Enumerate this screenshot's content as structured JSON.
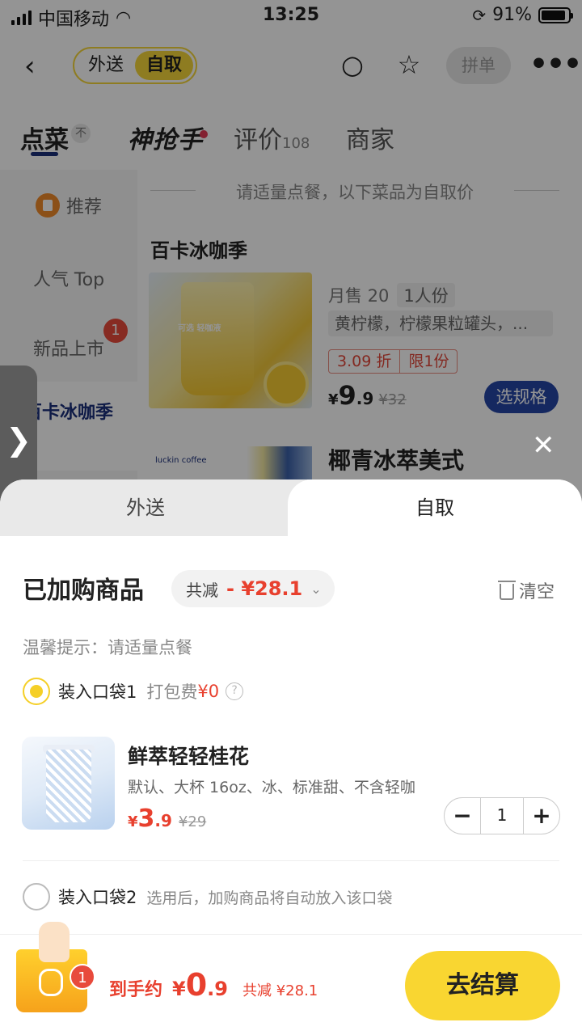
{
  "status_bar": {
    "carrier": "中国移动",
    "time": "13:25",
    "battery": "91%"
  },
  "nav": {
    "mode_delivery": "外送",
    "mode_pickup": "自取",
    "group_order": "拼单"
  },
  "tabs": {
    "order": "点菜",
    "order_badge": "不",
    "brand": "神抢手",
    "review": "评价",
    "review_count": "108",
    "merchant": "商家"
  },
  "sidebar": {
    "items": [
      {
        "label": "推荐"
      },
      {
        "label": "人气 Top"
      },
      {
        "label": "新品上市",
        "badge": "1"
      },
      {
        "label": "百卡冰咖季"
      }
    ]
  },
  "menu": {
    "notice": "请适量点餐，以下菜品为自取价",
    "section_title": "百卡冰咖季",
    "product1": {
      "image_text": "可选 轻咖液",
      "monthly_sales": "月售 20",
      "serving": "1人份",
      "desc": "黄柠檬，柠檬果粒罐头，...",
      "discount": "3.09 折",
      "limit": "限1份",
      "price_currency": "¥",
      "price_int": "9",
      "price_dec": ".9",
      "orig_price": "¥32",
      "spec_button": "选规格"
    },
    "product2": {
      "logo": "luckin coffee",
      "title": "椰青冰萃美式"
    }
  },
  "sheet": {
    "tab_delivery": "外送",
    "tab_pickup": "自取",
    "title": "已加购商品",
    "reduce_label": "共减",
    "reduce_amount": "- ¥28.1",
    "clear": "清空",
    "tip": "温馨提示：请适量点餐",
    "bag1": {
      "label": "装入口袋1",
      "fee_label": "打包费",
      "fee": "¥0"
    },
    "item": {
      "title": "鲜萃轻轻桂花",
      "spec": "默认、大杯 16oz、冰、标准甜、不含轻咖",
      "price_currency": "¥",
      "price_int": "3",
      "price_dec": ".9",
      "orig_price": "¥29",
      "quantity": "1"
    },
    "bag2": {
      "label": "装入口袋2",
      "hint": "选用后，加购商品将自动放入该口袋"
    }
  },
  "footer": {
    "cart_count": "1",
    "total_label": "到手约",
    "total_currency": "¥",
    "total_int": "0",
    "total_dec": ".9",
    "saved": "共减 ¥28.1",
    "checkout": "去结算"
  },
  "colors": {
    "accent_yellow": "#f9d631",
    "brand_blue": "#2546a6",
    "price_red": "#e8402e"
  }
}
